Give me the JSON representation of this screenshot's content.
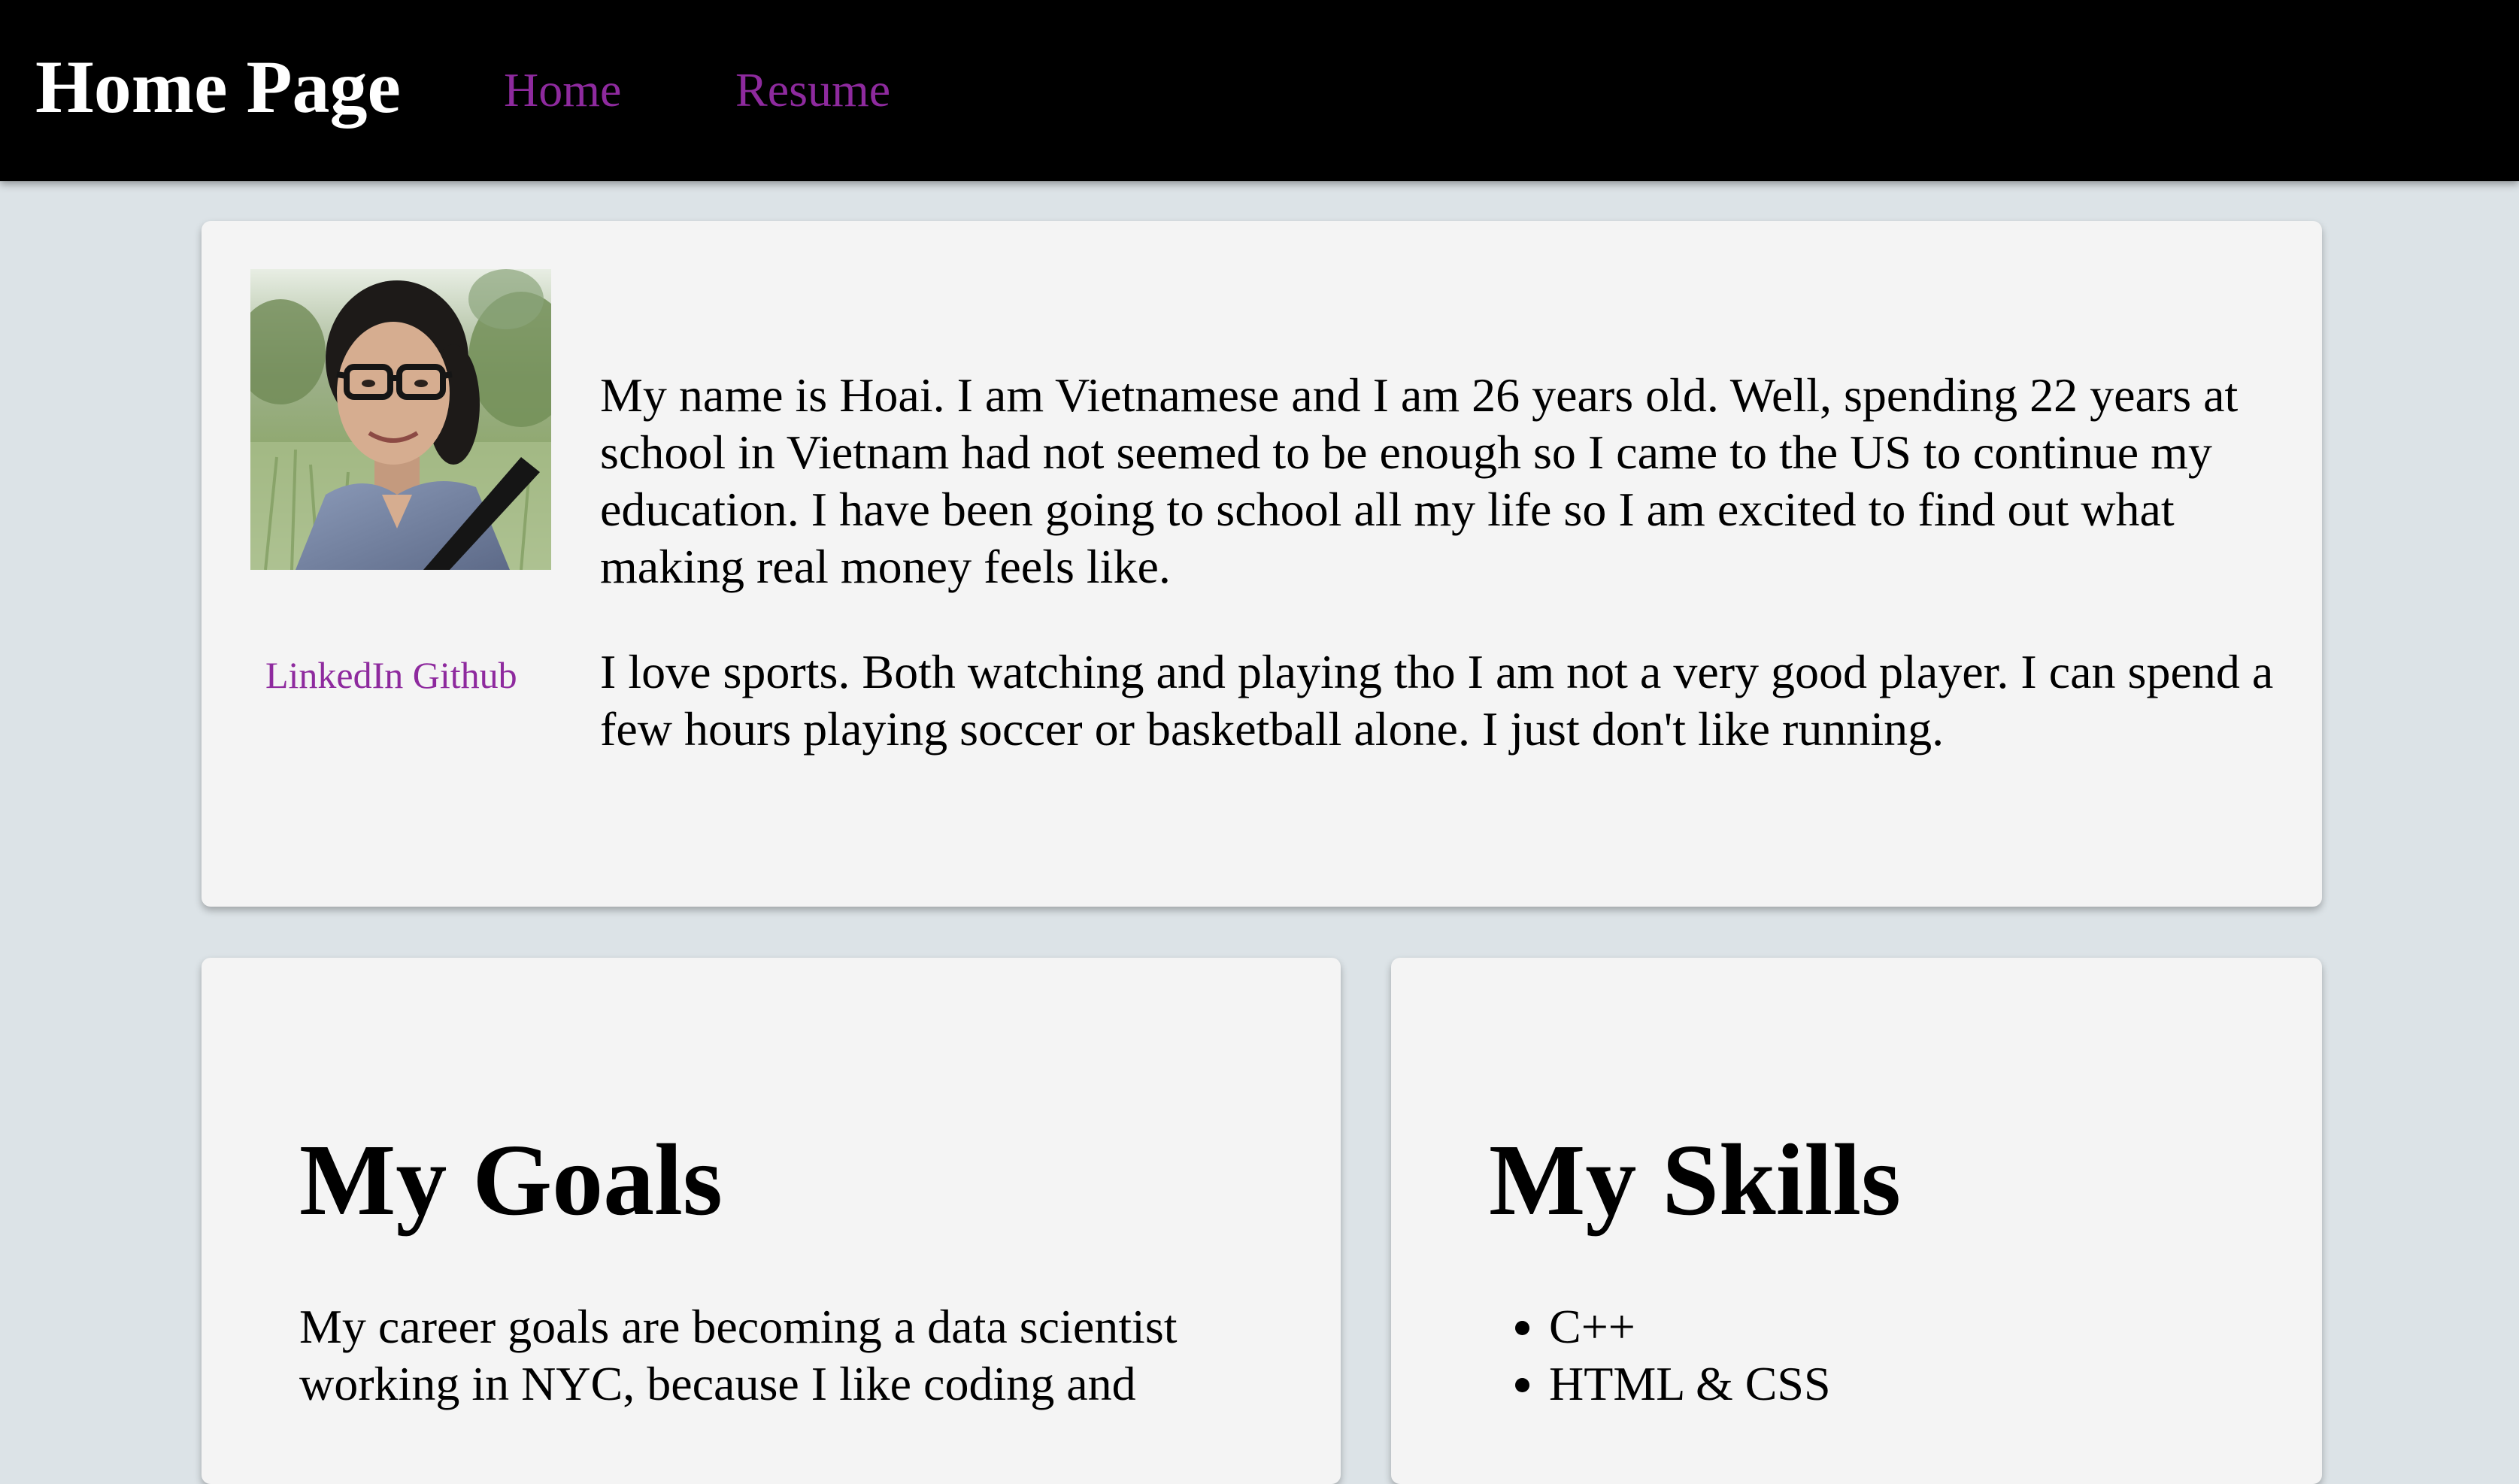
{
  "header": {
    "brand": "Home Page",
    "nav": [
      {
        "label": "Home"
      },
      {
        "label": "Resume"
      }
    ]
  },
  "intro": {
    "photo_alt": "profile photo",
    "links": {
      "linkedin": "LinkedIn",
      "github": "Github"
    },
    "paragraphs": [
      "My name is Hoai. I am Vietnamese and I am 26 years old. Well, spending 22 years at school in Vietnam had not seemed to be enough so I came to the US to continue my education. I have been going to school all my life so I am excited to find out what making real money feels like.",
      "I love sports. Both watching and playing tho I am not a very good player. I can spend a few hours playing soccer or basketball alone. I just don't like running."
    ]
  },
  "goals": {
    "title": "My Goals",
    "text": "My career goals are becoming a data scientist working in NYC, because I like coding and"
  },
  "skills": {
    "title": "My Skills",
    "items": [
      "C++",
      "HTML & CSS"
    ]
  },
  "colors": {
    "background": "#dce3e7",
    "navbar": "#000000",
    "card": "#f4f4f4",
    "link": "#8e2a9e"
  }
}
